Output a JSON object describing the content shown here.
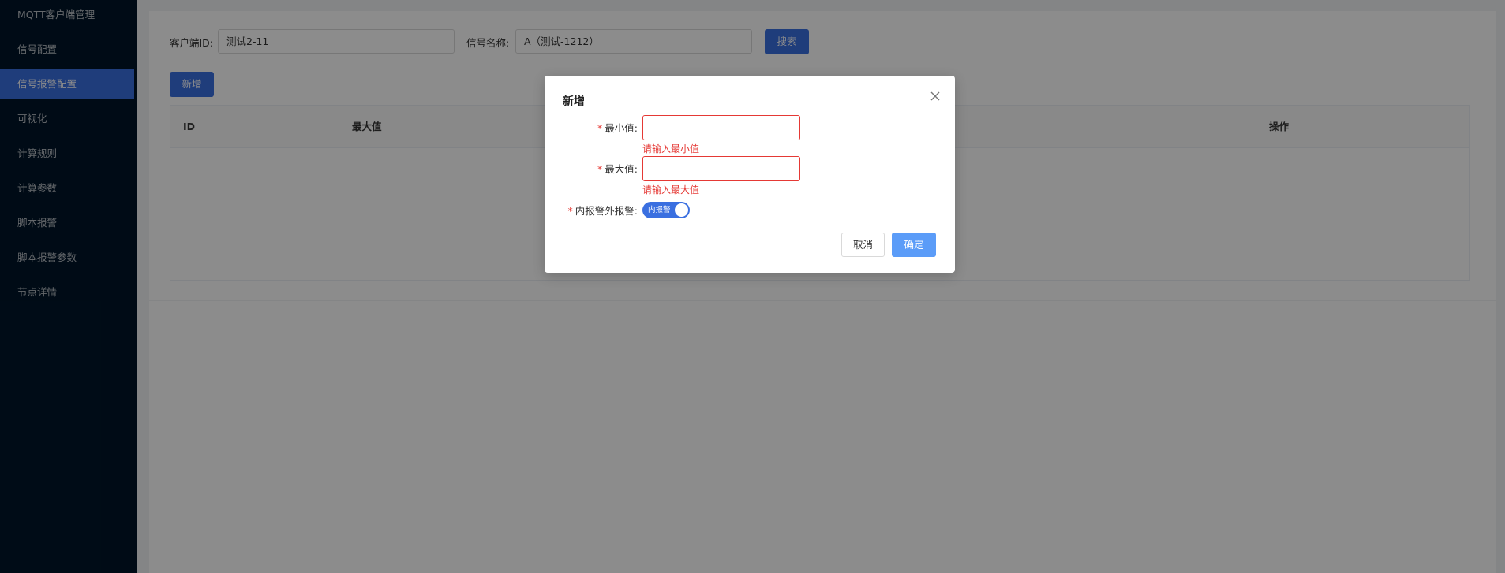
{
  "sidebar": {
    "items": [
      {
        "label": "MQTT客户端管理",
        "active": false
      },
      {
        "label": "信号配置",
        "active": false
      },
      {
        "label": "信号报警配置",
        "active": true
      },
      {
        "label": "可视化",
        "active": false
      },
      {
        "label": "计算规则",
        "active": false
      },
      {
        "label": "计算参数",
        "active": false
      },
      {
        "label": "脚本报警",
        "active": false
      },
      {
        "label": "脚本报警参数",
        "active": false
      },
      {
        "label": "节点详情",
        "active": false
      }
    ]
  },
  "search": {
    "client_id_label": "客户端ID:",
    "client_id_value": "测试2-11",
    "signal_name_label": "信号名称:",
    "signal_name_value": "A（测试-1212）",
    "search_button": "搜索"
  },
  "toolbar": {
    "add_button": "新增"
  },
  "table": {
    "columns": [
      "ID",
      "最大值",
      "操作"
    ]
  },
  "dialog": {
    "title": "新增",
    "fields": {
      "min_label": "最小值:",
      "min_error": "请输入最小值",
      "max_label": "最大值:",
      "max_error": "请输入最大值",
      "alarm_type_label": "内报警外报警:",
      "alarm_switch_text": "内报警"
    },
    "required_mark": "*",
    "cancel_button": "取消",
    "ok_button": "确定"
  },
  "colors": {
    "sidebar_bg": "#001529",
    "primary": "#3a6fe0",
    "error": "#e53935",
    "ok_button": "#5b9cf8"
  }
}
